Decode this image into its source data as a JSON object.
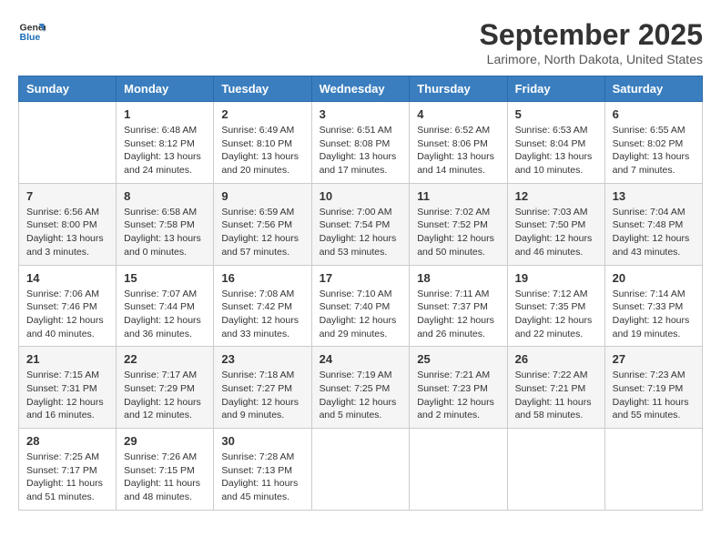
{
  "header": {
    "logo_line1": "General",
    "logo_line2": "Blue",
    "month_title": "September 2025",
    "location": "Larimore, North Dakota, United States"
  },
  "weekdays": [
    "Sunday",
    "Monday",
    "Tuesday",
    "Wednesday",
    "Thursday",
    "Friday",
    "Saturday"
  ],
  "weeks": [
    [
      {
        "day": "",
        "info": ""
      },
      {
        "day": "1",
        "info": "Sunrise: 6:48 AM\nSunset: 8:12 PM\nDaylight: 13 hours\nand 24 minutes."
      },
      {
        "day": "2",
        "info": "Sunrise: 6:49 AM\nSunset: 8:10 PM\nDaylight: 13 hours\nand 20 minutes."
      },
      {
        "day": "3",
        "info": "Sunrise: 6:51 AM\nSunset: 8:08 PM\nDaylight: 13 hours\nand 17 minutes."
      },
      {
        "day": "4",
        "info": "Sunrise: 6:52 AM\nSunset: 8:06 PM\nDaylight: 13 hours\nand 14 minutes."
      },
      {
        "day": "5",
        "info": "Sunrise: 6:53 AM\nSunset: 8:04 PM\nDaylight: 13 hours\nand 10 minutes."
      },
      {
        "day": "6",
        "info": "Sunrise: 6:55 AM\nSunset: 8:02 PM\nDaylight: 13 hours\nand 7 minutes."
      }
    ],
    [
      {
        "day": "7",
        "info": "Sunrise: 6:56 AM\nSunset: 8:00 PM\nDaylight: 13 hours\nand 3 minutes."
      },
      {
        "day": "8",
        "info": "Sunrise: 6:58 AM\nSunset: 7:58 PM\nDaylight: 13 hours\nand 0 minutes."
      },
      {
        "day": "9",
        "info": "Sunrise: 6:59 AM\nSunset: 7:56 PM\nDaylight: 12 hours\nand 57 minutes."
      },
      {
        "day": "10",
        "info": "Sunrise: 7:00 AM\nSunset: 7:54 PM\nDaylight: 12 hours\nand 53 minutes."
      },
      {
        "day": "11",
        "info": "Sunrise: 7:02 AM\nSunset: 7:52 PM\nDaylight: 12 hours\nand 50 minutes."
      },
      {
        "day": "12",
        "info": "Sunrise: 7:03 AM\nSunset: 7:50 PM\nDaylight: 12 hours\nand 46 minutes."
      },
      {
        "day": "13",
        "info": "Sunrise: 7:04 AM\nSunset: 7:48 PM\nDaylight: 12 hours\nand 43 minutes."
      }
    ],
    [
      {
        "day": "14",
        "info": "Sunrise: 7:06 AM\nSunset: 7:46 PM\nDaylight: 12 hours\nand 40 minutes."
      },
      {
        "day": "15",
        "info": "Sunrise: 7:07 AM\nSunset: 7:44 PM\nDaylight: 12 hours\nand 36 minutes."
      },
      {
        "day": "16",
        "info": "Sunrise: 7:08 AM\nSunset: 7:42 PM\nDaylight: 12 hours\nand 33 minutes."
      },
      {
        "day": "17",
        "info": "Sunrise: 7:10 AM\nSunset: 7:40 PM\nDaylight: 12 hours\nand 29 minutes."
      },
      {
        "day": "18",
        "info": "Sunrise: 7:11 AM\nSunset: 7:37 PM\nDaylight: 12 hours\nand 26 minutes."
      },
      {
        "day": "19",
        "info": "Sunrise: 7:12 AM\nSunset: 7:35 PM\nDaylight: 12 hours\nand 22 minutes."
      },
      {
        "day": "20",
        "info": "Sunrise: 7:14 AM\nSunset: 7:33 PM\nDaylight: 12 hours\nand 19 minutes."
      }
    ],
    [
      {
        "day": "21",
        "info": "Sunrise: 7:15 AM\nSunset: 7:31 PM\nDaylight: 12 hours\nand 16 minutes."
      },
      {
        "day": "22",
        "info": "Sunrise: 7:17 AM\nSunset: 7:29 PM\nDaylight: 12 hours\nand 12 minutes."
      },
      {
        "day": "23",
        "info": "Sunrise: 7:18 AM\nSunset: 7:27 PM\nDaylight: 12 hours\nand 9 minutes."
      },
      {
        "day": "24",
        "info": "Sunrise: 7:19 AM\nSunset: 7:25 PM\nDaylight: 12 hours\nand 5 minutes."
      },
      {
        "day": "25",
        "info": "Sunrise: 7:21 AM\nSunset: 7:23 PM\nDaylight: 12 hours\nand 2 minutes."
      },
      {
        "day": "26",
        "info": "Sunrise: 7:22 AM\nSunset: 7:21 PM\nDaylight: 11 hours\nand 58 minutes."
      },
      {
        "day": "27",
        "info": "Sunrise: 7:23 AM\nSunset: 7:19 PM\nDaylight: 11 hours\nand 55 minutes."
      }
    ],
    [
      {
        "day": "28",
        "info": "Sunrise: 7:25 AM\nSunset: 7:17 PM\nDaylight: 11 hours\nand 51 minutes."
      },
      {
        "day": "29",
        "info": "Sunrise: 7:26 AM\nSunset: 7:15 PM\nDaylight: 11 hours\nand 48 minutes."
      },
      {
        "day": "30",
        "info": "Sunrise: 7:28 AM\nSunset: 7:13 PM\nDaylight: 11 hours\nand 45 minutes."
      },
      {
        "day": "",
        "info": ""
      },
      {
        "day": "",
        "info": ""
      },
      {
        "day": "",
        "info": ""
      },
      {
        "day": "",
        "info": ""
      }
    ]
  ]
}
